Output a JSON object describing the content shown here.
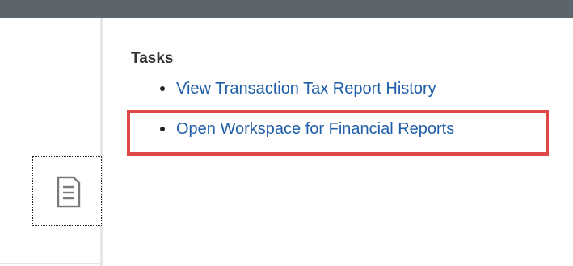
{
  "tasks": {
    "heading": "Tasks",
    "items": [
      {
        "label": "View Transaction Tax Report History"
      },
      {
        "label": "Open Workspace for Financial Reports"
      }
    ],
    "highlighted_item_index": 1
  },
  "left_panel": {
    "tile_icon": "report-document-icon"
  },
  "colors": {
    "top_bar": "#5d656c",
    "link": "#1f5ea8",
    "highlight": "#e04848",
    "heading": "#333333"
  }
}
